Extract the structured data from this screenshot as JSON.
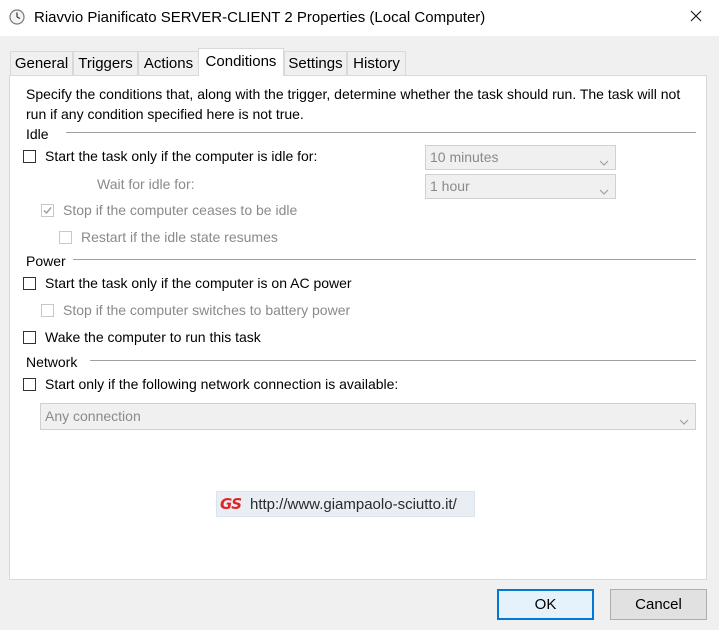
{
  "window": {
    "title": "Riavvio Pianificato SERVER-CLIENT 2 Properties (Local Computer)",
    "title_icon": "clock-icon",
    "close_icon": "close-icon"
  },
  "tabs": [
    {
      "label": "General",
      "active": false
    },
    {
      "label": "Triggers",
      "active": false
    },
    {
      "label": "Actions",
      "active": false
    },
    {
      "label": "Conditions",
      "active": true
    },
    {
      "label": "Settings",
      "active": false
    },
    {
      "label": "History",
      "active": false
    }
  ],
  "conditions": {
    "description": "Specify the conditions that, along with the trigger, determine whether the task should run.  The task will not run  if any condition specified here is not true.",
    "idle": {
      "section_label": "Idle",
      "start_if_idle": {
        "label": "Start the task only if the computer is idle for:",
        "checked": false,
        "enabled": true
      },
      "idle_duration": {
        "value": "10 minutes",
        "enabled": false
      },
      "wait_label": "Wait for idle for:",
      "wait_duration": {
        "value": "1 hour",
        "enabled": false
      },
      "stop_if_ceases": {
        "label": "Stop if the computer ceases to be idle",
        "checked": true,
        "enabled": false
      },
      "restart_if_resumes": {
        "label": "Restart if the idle state resumes",
        "checked": false,
        "enabled": false
      }
    },
    "power": {
      "section_label": "Power",
      "ac_power": {
        "label": "Start the task only if the computer is on AC power",
        "checked": false,
        "enabled": true
      },
      "battery_stop": {
        "label": "Stop if the computer switches to battery power",
        "checked": false,
        "enabled": false
      },
      "wake": {
        "label": "Wake the computer to run this task",
        "checked": false,
        "enabled": true
      }
    },
    "network": {
      "section_label": "Network",
      "start_if_network": {
        "label": "Start only if the following network connection is available:",
        "checked": false,
        "enabled": true
      },
      "connection": {
        "value": "Any connection",
        "enabled": false
      }
    },
    "watermark": {
      "logo": "GS",
      "url": "http://www.giampaolo-sciutto.it/"
    }
  },
  "buttons": {
    "ok": "OK",
    "cancel": "Cancel"
  },
  "colors": {
    "accent": "#0078d7",
    "disabled_text": "#8a8a8a",
    "watermark_red": "#e02424"
  }
}
